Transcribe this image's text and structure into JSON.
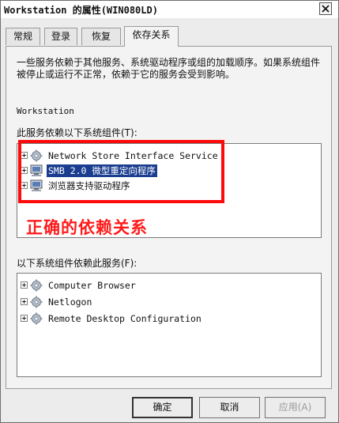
{
  "window": {
    "title": "Workstation 的属性(WIN080LD)"
  },
  "tabs": [
    {
      "label": "常规"
    },
    {
      "label": "登录"
    },
    {
      "label": "恢复"
    },
    {
      "label": "依存关系"
    }
  ],
  "panel": {
    "description": "一些服务依赖于其他服务、系统驱动程序或组的加载顺序。如果系统组件被停止或运行不正常，依赖于它的服务会受到影响。",
    "service_name": "Workstation",
    "depends_on_label": "此服务依赖以下系统组件(T):",
    "depends_on_items": [
      {
        "label": "Network Store Interface Service",
        "icon": "gear-service-icon",
        "selected": false
      },
      {
        "label": "SMB 2.0 微型重定向程序",
        "icon": "computer-icon",
        "selected": true
      },
      {
        "label": "浏览器支持驱动程序",
        "icon": "computer-icon",
        "selected": false
      }
    ],
    "dependents_label": "以下系统组件依赖此服务(F):",
    "dependents_items": [
      {
        "label": "Computer Browser",
        "icon": "gear-service-icon"
      },
      {
        "label": "Netlogon",
        "icon": "gear-service-icon"
      },
      {
        "label": "Remote Desktop Configuration",
        "icon": "gear-service-icon"
      }
    ]
  },
  "annotation": {
    "text": "正确的依赖关系",
    "color": "#ff1a1a"
  },
  "buttons": {
    "ok": "确定",
    "cancel": "取消",
    "apply": "应用(A)"
  }
}
